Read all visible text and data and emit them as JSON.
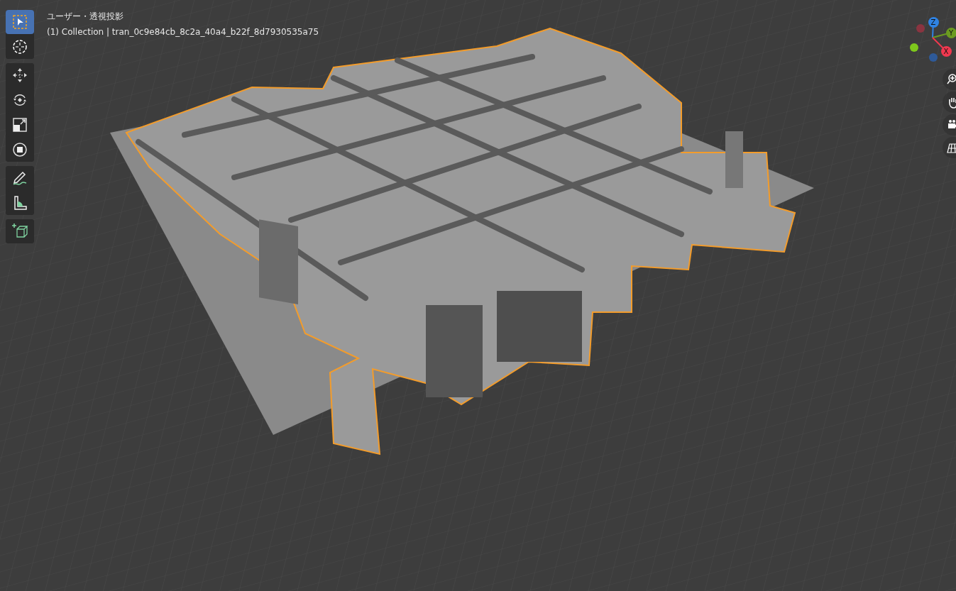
{
  "viewport": {
    "view_name": "ユーザー・透視投影",
    "object_info": "(1) Collection | tran_0c9e84cb_8c2a_40a4_b22f_8d7930535a75"
  },
  "toolbar": [
    [
      {
        "kind": "select",
        "selected": true
      },
      {
        "kind": "cursor",
        "selected": false
      }
    ],
    [
      {
        "kind": "move",
        "selected": false
      },
      {
        "kind": "rotate",
        "selected": false
      },
      {
        "kind": "scale",
        "selected": false
      },
      {
        "kind": "transform",
        "selected": false
      }
    ],
    [
      {
        "kind": "annotate",
        "selected": false
      },
      {
        "kind": "measure",
        "selected": false
      }
    ],
    [
      {
        "kind": "add_cube",
        "selected": false
      }
    ]
  ],
  "gizmo": {
    "axes": [
      {
        "label": "Z",
        "color": "#2f83e4"
      },
      {
        "label": "Y",
        "color": "#6b9b20"
      },
      {
        "label": "X",
        "color": "#f0384f"
      }
    ]
  }
}
